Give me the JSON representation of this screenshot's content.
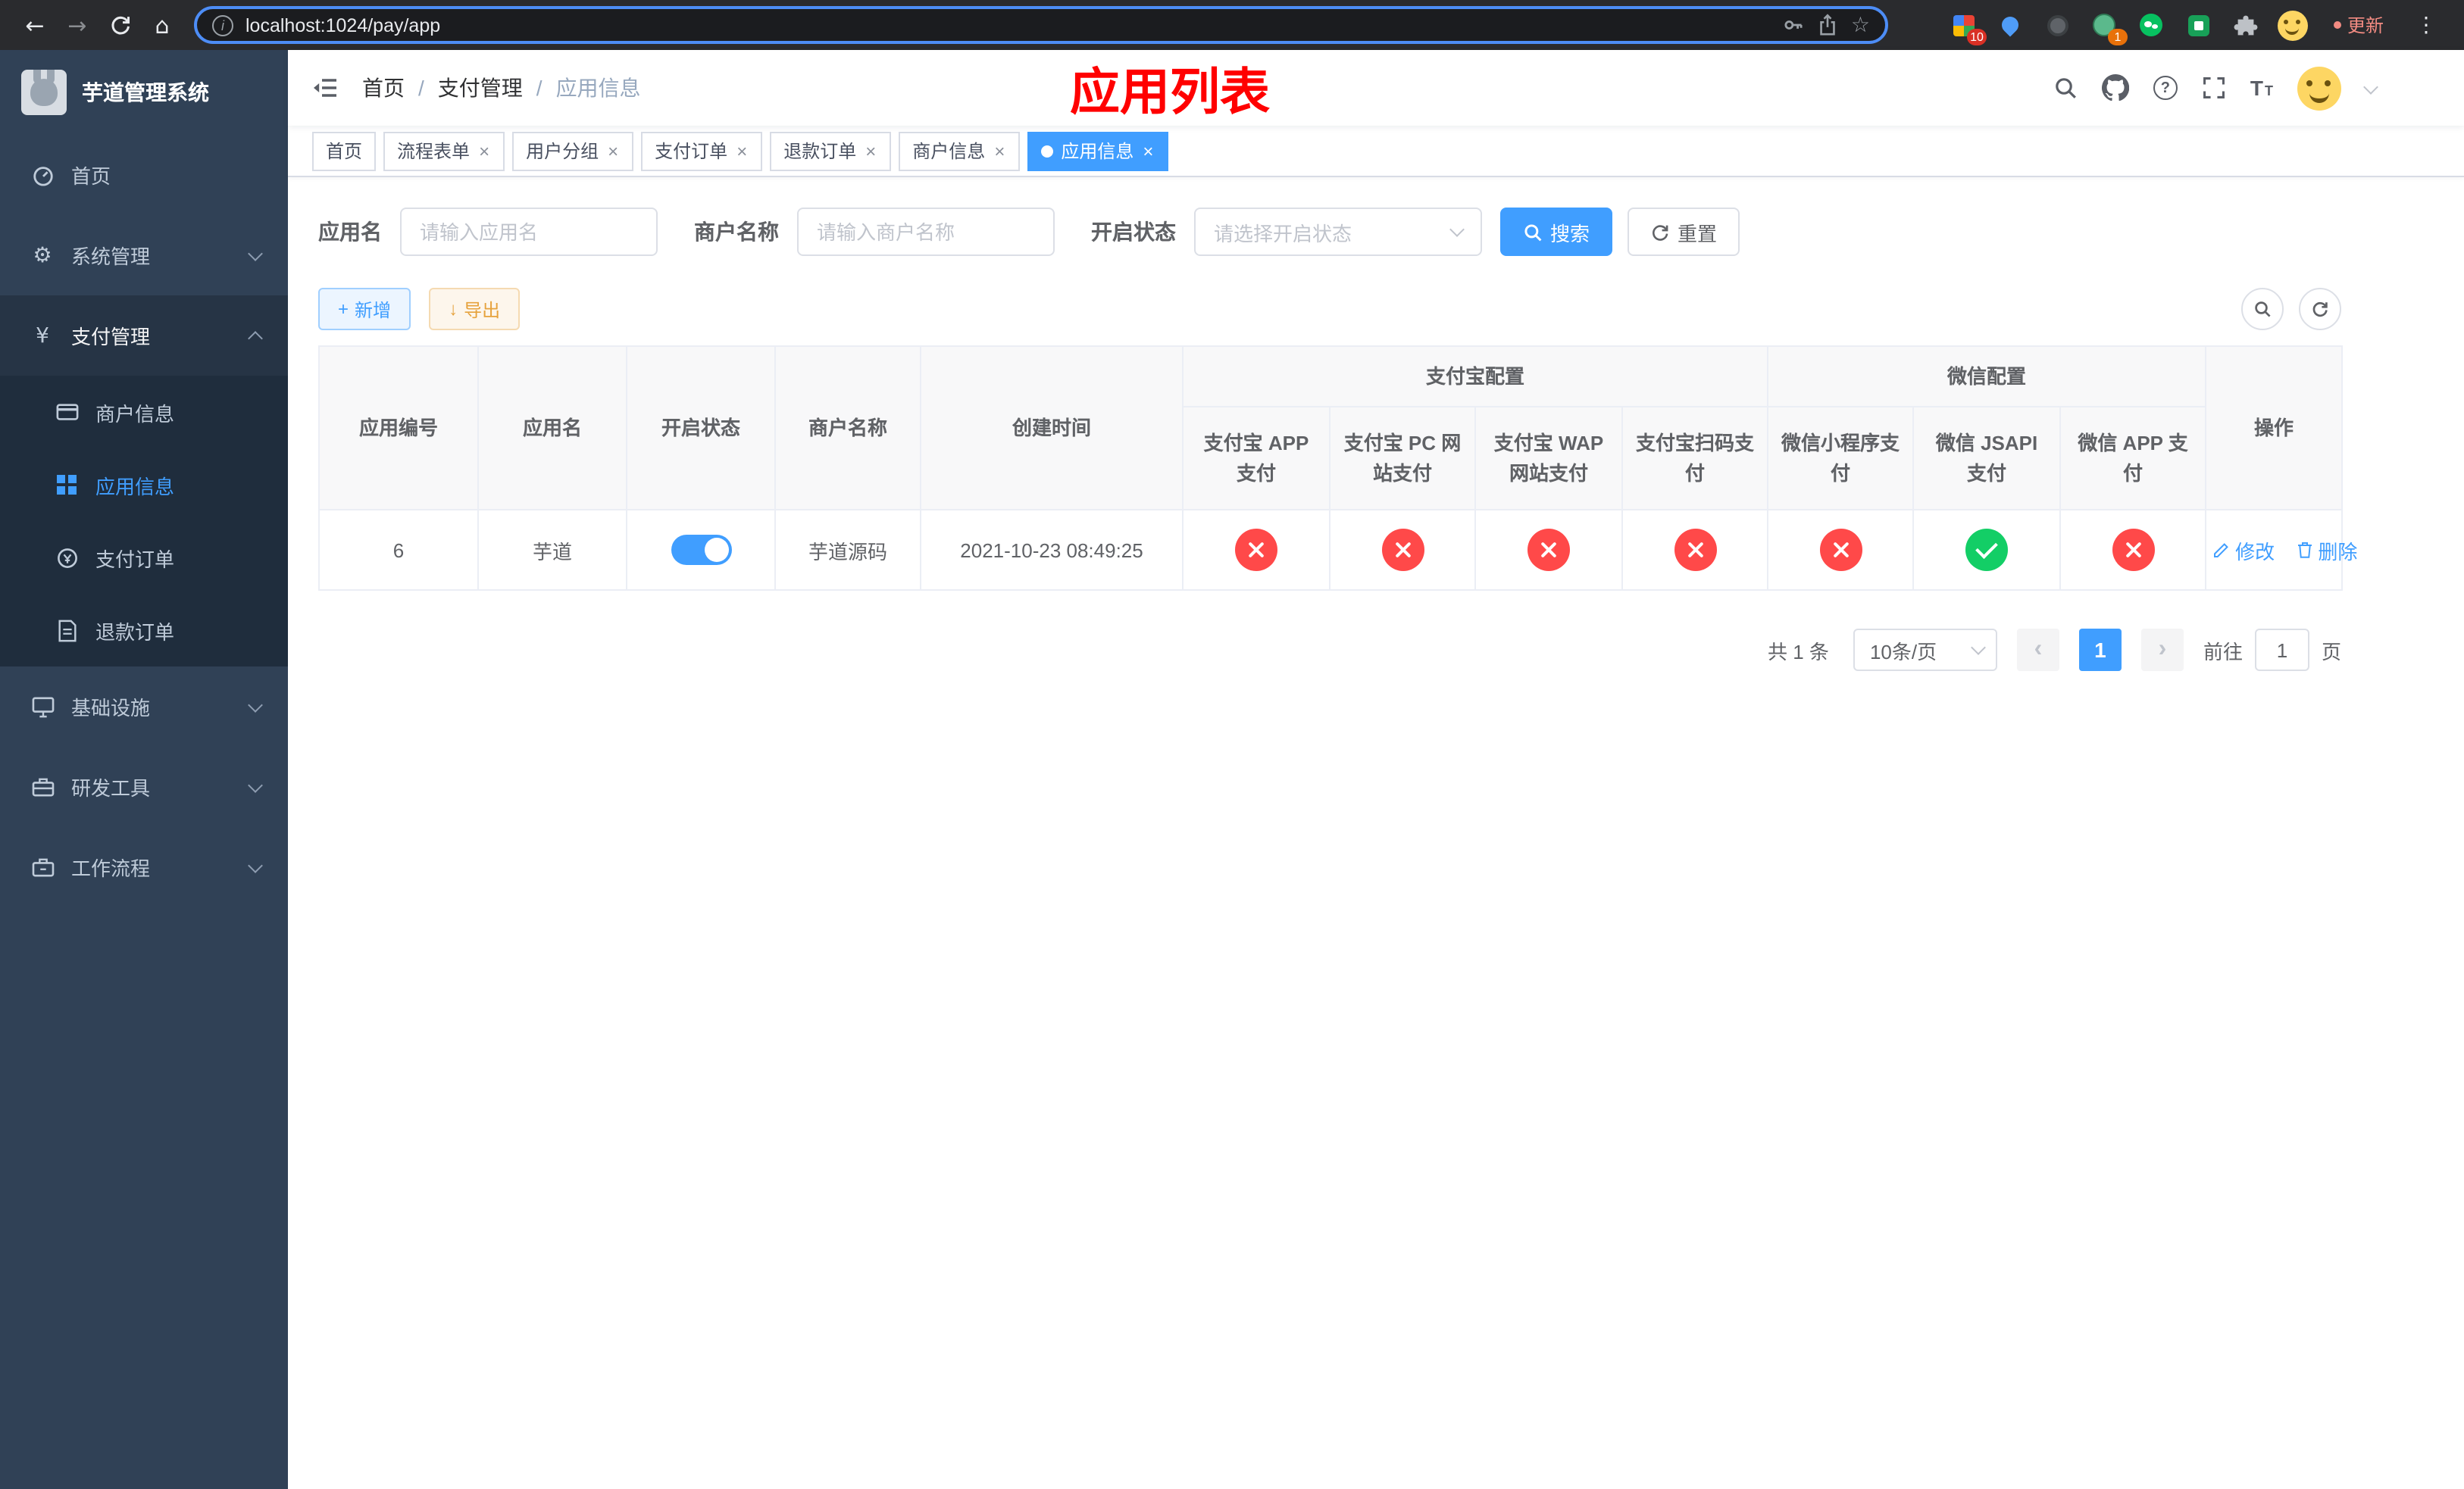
{
  "browser": {
    "url": "localhost:1024/pay/app",
    "update_label": "更新",
    "extensions_badge": "10",
    "profile_badge": "1"
  },
  "icons": {
    "back": "←",
    "forward": "→",
    "home": "⌂",
    "star": "☆",
    "more": "⋮",
    "info": "i",
    "help": "?",
    "plus": "+",
    "download": "↓",
    "prev": "‹",
    "next": "›",
    "font_large": "T",
    "font_small": "T",
    "gear": "⚙",
    "yen": "¥"
  },
  "sidebar": {
    "title": "芋道管理系统",
    "items": [
      {
        "label": "首页"
      },
      {
        "label": "系统管理"
      },
      {
        "label": "支付管理"
      },
      {
        "label": "基础设施"
      },
      {
        "label": "研发工具"
      },
      {
        "label": "工作流程"
      }
    ],
    "submenu": [
      {
        "label": "商户信息"
      },
      {
        "label": "应用信息"
      },
      {
        "label": "支付订单"
      },
      {
        "label": "退款订单"
      }
    ]
  },
  "header": {
    "breadcrumb": [
      "首页",
      "支付管理",
      "应用信息"
    ],
    "separator": "/",
    "title": "应用列表"
  },
  "tabs": [
    {
      "label": "首页",
      "closable": false,
      "active": false
    },
    {
      "label": "流程表单",
      "closable": true,
      "active": false
    },
    {
      "label": "用户分组",
      "closable": true,
      "active": false
    },
    {
      "label": "支付订单",
      "closable": true,
      "active": false
    },
    {
      "label": "退款订单",
      "closable": true,
      "active": false
    },
    {
      "label": "商户信息",
      "closable": true,
      "active": false
    },
    {
      "label": "应用信息",
      "closable": true,
      "active": true
    }
  ],
  "filters": {
    "app_name_label": "应用名",
    "app_name_placeholder": "请输入应用名",
    "merchant_label": "商户名称",
    "merchant_placeholder": "请输入商户名称",
    "status_label": "开启状态",
    "status_placeholder": "请选择开启状态",
    "search_label": "搜索",
    "reset_label": "重置"
  },
  "toolbar": {
    "add_label": "新增",
    "export_label": "导出"
  },
  "table": {
    "columns": {
      "app_id": "应用编号",
      "app_name": "应用名",
      "status": "开启状态",
      "merchant": "商户名称",
      "created": "创建时间",
      "alipay_group": "支付宝配置",
      "wechat_group": "微信配置",
      "alipay_app": "支付宝 APP 支付",
      "alipay_pc": "支付宝 PC 网站支付",
      "alipay_wap": "支付宝 WAP 网站支付",
      "alipay_qr": "支付宝扫码支付",
      "wx_mini": "微信小程序支付",
      "wx_jsapi": "微信 JSAPI 支付",
      "wx_app": "微信 APP 支付",
      "actions": "操作"
    },
    "row": {
      "id": "6",
      "name": "芋道",
      "enabled": true,
      "merchant": "芋道源码",
      "created": "2021-10-23 08:49:25",
      "statuses": [
        "no",
        "no",
        "no",
        "no",
        "no",
        "yes",
        "no"
      ],
      "edit_label": "修改",
      "delete_label": "删除"
    }
  },
  "pagination": {
    "total": "共 1 条",
    "page_size": "10条/页",
    "page": "1",
    "goto_prefix": "前往",
    "goto_value": "1",
    "goto_suffix": "页"
  },
  "colors": {
    "accent": "#409eff",
    "danger": "#ff4949",
    "success": "#13ce66",
    "warning": "#e6a23c",
    "title_red": "#ff0000",
    "sidebar_bg": "#304156",
    "submenu_bg": "#1f2d3d"
  }
}
